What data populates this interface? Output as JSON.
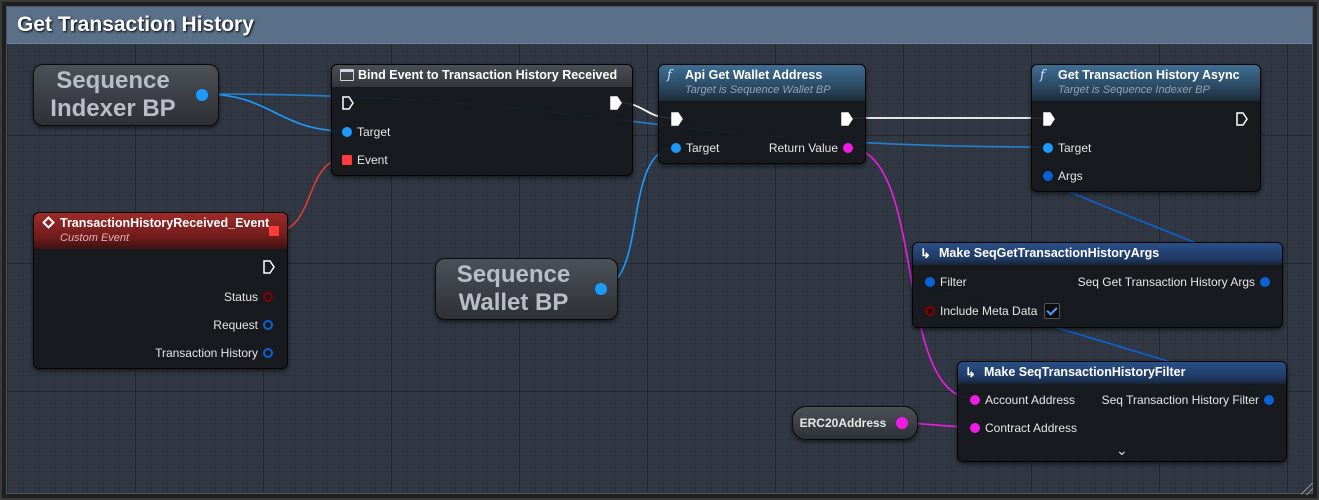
{
  "comment": {
    "title": "Get Transaction History",
    "color": "#5a6f88"
  },
  "colors": {
    "exec": "#ffffff",
    "object": "#1c9bff",
    "struct": "#0b62d6",
    "string": "#f01ce4",
    "delegate": "#ff3a3a",
    "bool": "#8a0000"
  },
  "variables": {
    "indexer": {
      "label": "Sequence\nIndexer BP"
    },
    "wallet": {
      "label": "Sequence\nWallet BP"
    },
    "erc20": {
      "label": "ERC20Address"
    }
  },
  "nodes": {
    "bind_event": {
      "title": "Bind Event to Transaction History Received",
      "icon": "bind-event-icon",
      "pins": {
        "target": "Target",
        "event": "Event"
      }
    },
    "get_wallet": {
      "title": "Api Get Wallet Address",
      "subtitle": "Target is Sequence Wallet BP",
      "icon": "function-icon",
      "pins": {
        "target": "Target",
        "return_value": "Return Value"
      }
    },
    "get_history": {
      "title": "Get Transaction History Async",
      "subtitle": "Target is Sequence Indexer BP",
      "icon": "function-icon",
      "pins": {
        "target": "Target",
        "args": "Args"
      }
    },
    "custom_event": {
      "title": "TransactionHistoryReceived_Event",
      "subtitle": "Custom Event",
      "icon": "event-icon",
      "pins": {
        "status": "Status",
        "request": "Request",
        "history": "Transaction History"
      }
    },
    "make_args": {
      "title": "Make SeqGetTransactionHistoryArgs",
      "icon": "make-struct-icon",
      "pins": {
        "filter": "Filter",
        "include_meta": "Include Meta Data",
        "output": "Seq Get Transaction History Args"
      },
      "include_meta_checked": true
    },
    "make_filter": {
      "title": "Make SeqTransactionHistoryFilter",
      "icon": "make-struct-icon",
      "pins": {
        "account": "Account Address",
        "contract": "Contract Address",
        "output": "Seq Transaction History Filter"
      }
    }
  }
}
